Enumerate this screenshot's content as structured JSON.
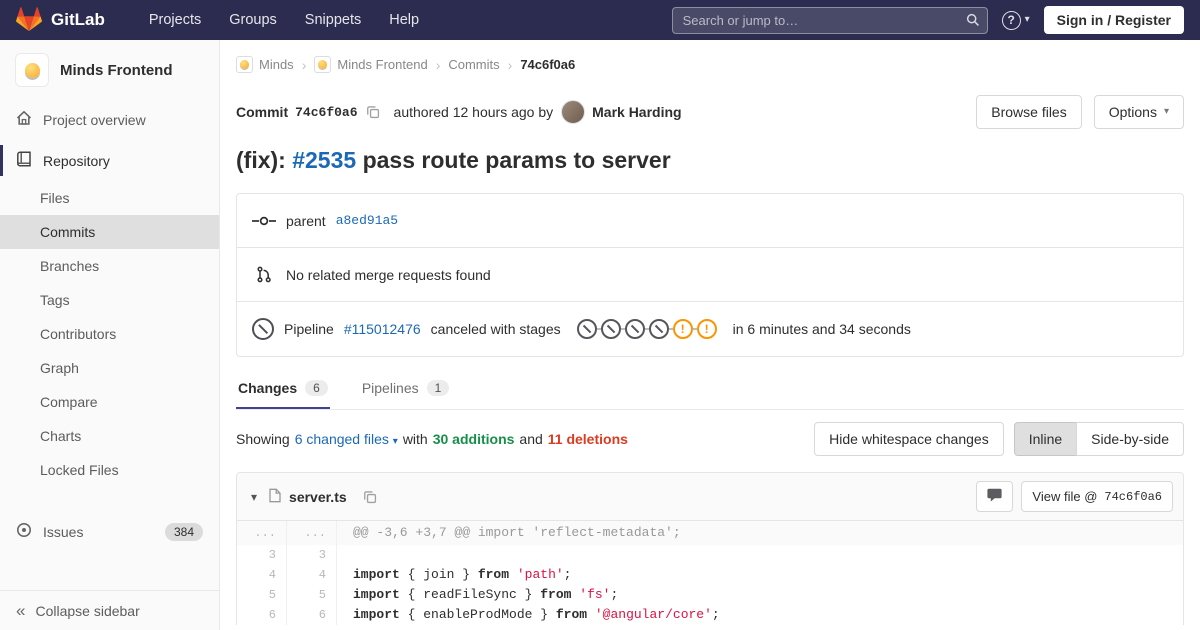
{
  "colors": {
    "navbar": "#2c2c50",
    "link": "#1b69b6",
    "additions": "#168f48",
    "deletions": "#db3b21",
    "warning": "#fc9403",
    "canceled": "#56565c"
  },
  "navbar": {
    "brand": "GitLab",
    "menu": [
      "Projects",
      "Groups",
      "Snippets",
      "Help"
    ],
    "search_placeholder": "Search or jump to…",
    "help_glyph": "?",
    "sign_in_label": "Sign in / Register"
  },
  "sidebar": {
    "project_name": "Minds Frontend",
    "overview_label": "Project overview",
    "repository_label": "Repository",
    "repo_items": [
      "Files",
      "Commits",
      "Branches",
      "Tags",
      "Contributors",
      "Graph",
      "Compare",
      "Charts",
      "Locked Files"
    ],
    "issues_label": "Issues",
    "issues_count": "384",
    "collapse_label": "Collapse sidebar"
  },
  "breadcrumb": {
    "items": [
      "Minds",
      "Minds Frontend",
      "Commits",
      "74c6f0a6"
    ]
  },
  "commit": {
    "label": "Commit",
    "sha": "74c6f0a6",
    "authored_text": "authored 12 hours ago by",
    "author": "Mark Harding",
    "browse_files_label": "Browse files",
    "options_label": "Options",
    "title_prefix": "(fix): ",
    "title_issue": "#2535",
    "title_rest": " pass route params to server"
  },
  "info": {
    "parent_label": "parent",
    "parent_sha": "a8ed91a5",
    "mr_text": "No related merge requests found",
    "pipeline_label": "Pipeline",
    "pipeline_id": "#115012476",
    "pipeline_status": "canceled with stages",
    "pipeline_duration": "in 6 minutes and 34 seconds",
    "stages": [
      "canceled",
      "canceled",
      "canceled",
      "canceled",
      "warning",
      "warning"
    ]
  },
  "tabs": {
    "changes_label": "Changes",
    "changes_count": "6",
    "pipelines_label": "Pipelines",
    "pipelines_count": "1"
  },
  "summary": {
    "showing": "Showing",
    "changed_files": "6 changed files",
    "with_text": "with",
    "additions": "30 additions",
    "and_text": "and",
    "deletions": "11 deletions",
    "hide_whitespace_label": "Hide whitespace changes",
    "inline_label": "Inline",
    "side_by_side_label": "Side-by-side"
  },
  "diff": {
    "filename": "server.ts",
    "view_file_label": "View file @",
    "view_file_sha": "74c6f0a6",
    "rows": [
      {
        "old": "...",
        "new": "...",
        "kind": "hunk",
        "text": "@@ -3,6 +3,7 @@ import 'reflect-metadata';"
      },
      {
        "old": "3",
        "new": "3",
        "kind": "context",
        "text": ""
      },
      {
        "old": "4",
        "new": "4",
        "kind": "context",
        "k1": "import",
        "p1": " { join } ",
        "k2": "from",
        "p2": " ",
        "s1": "'path'",
        "p3": ";"
      },
      {
        "old": "5",
        "new": "5",
        "kind": "context",
        "k1": "import",
        "p1": " { readFileSync } ",
        "k2": "from",
        "p2": " ",
        "s1": "'fs'",
        "p3": ";"
      },
      {
        "old": "6",
        "new": "6",
        "kind": "context",
        "k1": "import",
        "p1": " { enableProdMode } ",
        "k2": "from",
        "p2": " ",
        "s1": "'@angular/core'",
        "p3": ";"
      }
    ]
  }
}
